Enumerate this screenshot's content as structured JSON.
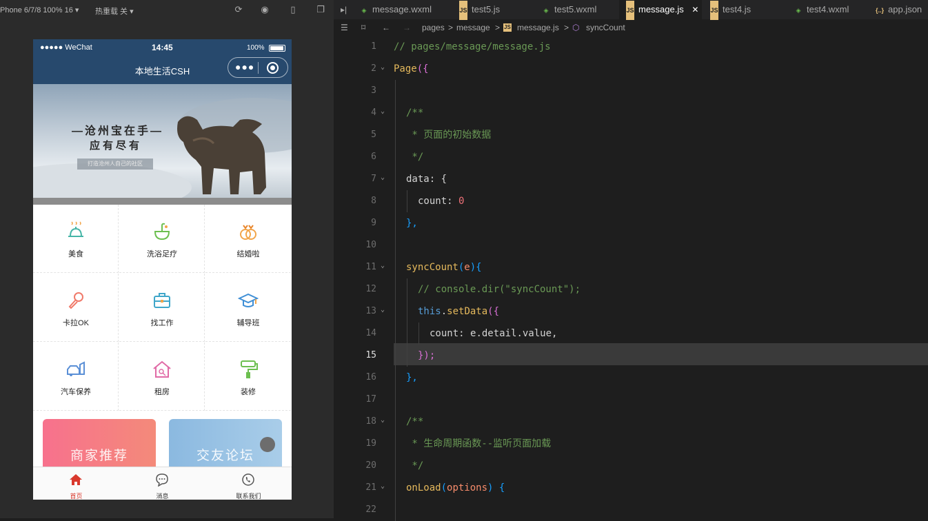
{
  "simulator": {
    "device_label": "Phone 6/7/8 100% 16 ▾",
    "hot_reload_label": "热重载 关 ▾",
    "statusbar": {
      "signal": "●●●●● WeChat",
      "time": "14:45",
      "battery": "100%"
    },
    "navbar": {
      "title": "本地生活CSH"
    },
    "banner": {
      "line1": "—沧州宝在手—",
      "line2": "应有尽有",
      "tagline": "打造沧州人自己的社区"
    },
    "grid": [
      {
        "label": "美食",
        "icon": "food-cloche-icon"
      },
      {
        "label": "洗浴足疗",
        "icon": "bath-icon"
      },
      {
        "label": "结婚啦",
        "icon": "rings-icon"
      },
      {
        "label": "卡拉OK",
        "icon": "microphone-icon"
      },
      {
        "label": "找工作",
        "icon": "briefcase-icon"
      },
      {
        "label": "辅导班",
        "icon": "graduation-cap-icon"
      },
      {
        "label": "汽车保养",
        "icon": "car-icon"
      },
      {
        "label": "租房",
        "icon": "house-icon"
      },
      {
        "label": "装修",
        "icon": "paint-roller-icon"
      }
    ],
    "cards": [
      {
        "label": "商家推荐",
        "color": "#f4728a"
      },
      {
        "label": "交友论坛",
        "color": "#8fbfe3"
      }
    ],
    "tabbar": [
      {
        "label": "首页",
        "icon": "home-icon",
        "active": true
      },
      {
        "label": "消息",
        "icon": "message-icon",
        "active": false
      },
      {
        "label": "联系我们",
        "icon": "phone-icon",
        "active": false
      }
    ],
    "colors": {
      "navbar": "#27496d",
      "tab_active": "#d9392d"
    }
  },
  "editor": {
    "tabs": [
      {
        "label": "message.wxml",
        "type": "wxml"
      },
      {
        "label": "test5.js",
        "type": "js"
      },
      {
        "label": "test5.wxml",
        "type": "wxml"
      },
      {
        "label": "message.js",
        "type": "js",
        "active": true,
        "close": "✕"
      },
      {
        "label": "test4.js",
        "type": "js"
      },
      {
        "label": "test4.wxml",
        "type": "wxml"
      },
      {
        "label": "app.json",
        "type": "json"
      }
    ],
    "breadcrumb": [
      "pages",
      ">",
      "message",
      ">",
      "message.js",
      ">",
      "syncCount"
    ],
    "current_line": "15",
    "line_numbers": [
      "1",
      "2",
      "3",
      "4",
      "5",
      "6",
      "7",
      "8",
      "9",
      "10",
      "11",
      "12",
      "13",
      "14",
      "15",
      "16",
      "17",
      "18",
      "19",
      "20",
      "21",
      "22"
    ],
    "code": {
      "l1": "// pages/message/message.js",
      "l2a": "Page",
      "l2b": "({",
      "l4": "/**",
      "l5": " * 页面的初始数据",
      "l6": " */",
      "l7a": "data",
      "l7b": ": {",
      "l8a": "count",
      "l8b": ": ",
      "l8c": "0",
      "l9": "},",
      "l11a": "syncCount",
      "l11b": "(",
      "l11c": "e",
      "l11d": "){",
      "l12": "// console.dir(\"syncCount\");",
      "l13a": "this",
      "l13b": ".",
      "l13c": "setData",
      "l13d": "({",
      "l14a": "count",
      "l14b": ": e.detail.value,",
      "l15a": "});",
      "l16": "},",
      "l18": "/**",
      "l19": " * 生命周期函数--监听页面加载",
      "l20": " */",
      "l21a": "onLoad",
      "l21b": "(",
      "l21c": "options",
      "l21d": ") {"
    }
  }
}
